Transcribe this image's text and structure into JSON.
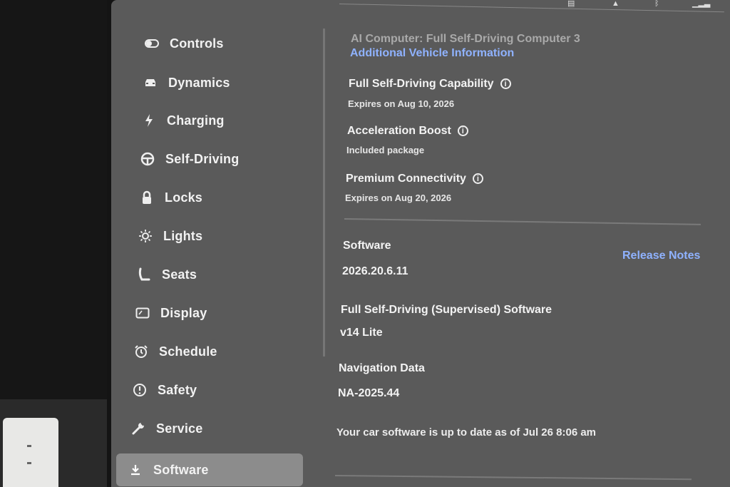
{
  "sidebar": {
    "items": [
      {
        "label": "Controls",
        "icon": "toggle-icon"
      },
      {
        "label": "Dynamics",
        "icon": "car-icon"
      },
      {
        "label": "Charging",
        "icon": "bolt-icon"
      },
      {
        "label": "Self-Driving",
        "icon": "steering-wheel-icon"
      },
      {
        "label": "Locks",
        "icon": "lock-icon"
      },
      {
        "label": "Lights",
        "icon": "sun-icon"
      },
      {
        "label": "Seats",
        "icon": "seat-icon"
      },
      {
        "label": "Display",
        "icon": "display-icon"
      },
      {
        "label": "Schedule",
        "icon": "alarm-clock-icon"
      },
      {
        "label": "Safety",
        "icon": "alert-circle-icon"
      },
      {
        "label": "Service",
        "icon": "wrench-icon"
      },
      {
        "label": "Software",
        "icon": "download-icon",
        "active": true
      }
    ]
  },
  "content": {
    "ai_computer": "AI Computer: Full Self-Driving Computer 3",
    "additional_info_link": "Additional Vehicle Information",
    "packages": [
      {
        "title": "Full Self-Driving Capability",
        "detail": "Expires on Aug 10, 2026"
      },
      {
        "title": "Acceleration Boost",
        "detail": "Included package"
      },
      {
        "title": "Premium Connectivity",
        "detail": "Expires on Aug 20, 2026"
      }
    ],
    "software_label": "Software",
    "release_notes_link": "Release Notes",
    "software_version": "2026.20.6.11",
    "fsd_label": "Full Self-Driving (Supervised) Software",
    "fsd_version": "v14 Lite",
    "nav_label": "Navigation Data",
    "nav_version": "NA-2025.44",
    "status": "Your car software is up to date as of Jul 26 8:06 am"
  },
  "colors": {
    "screen_bg": "#5a5a5a",
    "active_item_bg": "#8c8c8c",
    "link": "#8fb2ff"
  }
}
